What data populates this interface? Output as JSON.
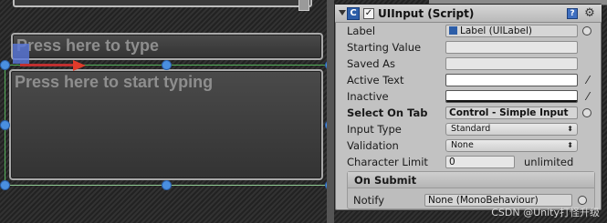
{
  "scene": {
    "input_small_text": "Press here to type",
    "input_large_text": "Press here to start typing"
  },
  "inspector": {
    "component_title": "UIInput (Script)",
    "enabled_check": "✓",
    "fields": {
      "label": {
        "name": "Label",
        "value": "Label (UILabel)"
      },
      "starting_value": {
        "name": "Starting Value",
        "value": ""
      },
      "saved_as": {
        "name": "Saved As",
        "value": ""
      },
      "active_text": {
        "name": "Active Text",
        "color": "#ffffff"
      },
      "inactive": {
        "name": "Inactive",
        "color": "#ffffff"
      },
      "select_on_tab": {
        "name": "Select On Tab",
        "value": "Control - Simple Input"
      },
      "input_type": {
        "name": "Input Type",
        "value": "Standard"
      },
      "validation": {
        "name": "Validation",
        "value": "None"
      },
      "character_limit": {
        "name": "Character Limit",
        "value": "0",
        "unit": "unlimited"
      }
    },
    "on_submit": {
      "title": "On Submit",
      "notify_label": "Notify",
      "notify_value": "None (MonoBehaviour)"
    }
  },
  "watermark": "CSDN @Unity打怪升级",
  "colors": {
    "scene_bg": "#2b2b2b",
    "inspector_bg": "#c2c2c2",
    "selection_green": "#55b05a",
    "handle_blue": "#4a8fe0",
    "arrow_red": "#e03b2a"
  }
}
